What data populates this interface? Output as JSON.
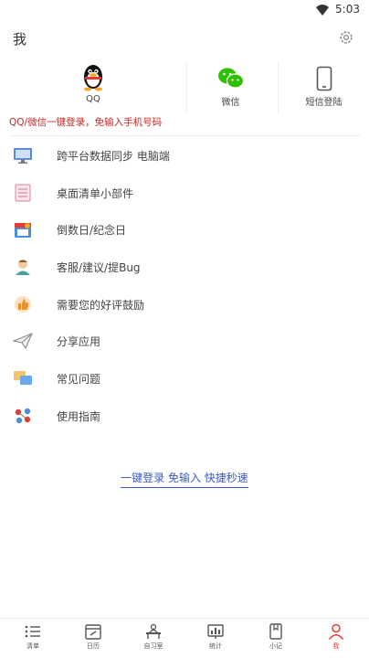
{
  "status_bar": {
    "time": "5:03",
    "wifi_icon": "wifi-icon"
  },
  "header": {
    "title": "我",
    "settings_icon": "gear-icon"
  },
  "login_options": [
    {
      "label": "QQ",
      "icon": "qq-penguin-icon"
    },
    {
      "label": "微信",
      "icon": "wechat-icon"
    },
    {
      "label": "短信登陆",
      "icon": "phone-icon"
    }
  ],
  "promo_text": "QQ/微信一键登录，免输入手机号码",
  "menu": [
    {
      "label": "跨平台数据同步 电脑端",
      "icon": "monitor-icon"
    },
    {
      "label": "桌面清单小部件",
      "icon": "widget-list-icon"
    },
    {
      "label": "倒数日/纪念日",
      "icon": "calendar-icon"
    },
    {
      "label": "客服/建议/提Bug",
      "icon": "customer-service-icon"
    },
    {
      "label": "需要您的好评鼓励",
      "icon": "thumbs-up-icon"
    },
    {
      "label": "分享应用",
      "icon": "paper-plane-icon"
    },
    {
      "label": "常见问题",
      "icon": "faq-icon"
    },
    {
      "label": "使用指南",
      "icon": "guide-icon"
    }
  ],
  "quick_login": "一键登录 免输入 快捷秒速",
  "tabs": [
    {
      "label": "清单",
      "icon": "list-icon",
      "active": false
    },
    {
      "label": "日历",
      "icon": "calendar-tab-icon",
      "active": false
    },
    {
      "label": "自习室",
      "icon": "study-room-icon",
      "active": false
    },
    {
      "label": "统计",
      "icon": "stats-icon",
      "active": false
    },
    {
      "label": "小记",
      "icon": "note-icon",
      "active": false
    },
    {
      "label": "我",
      "icon": "person-icon",
      "active": true
    }
  ],
  "colors": {
    "accent_red": "#e53935",
    "promo_red": "#c62828",
    "link_blue": "#3d5bbf",
    "wechat_green": "#2dc100"
  }
}
